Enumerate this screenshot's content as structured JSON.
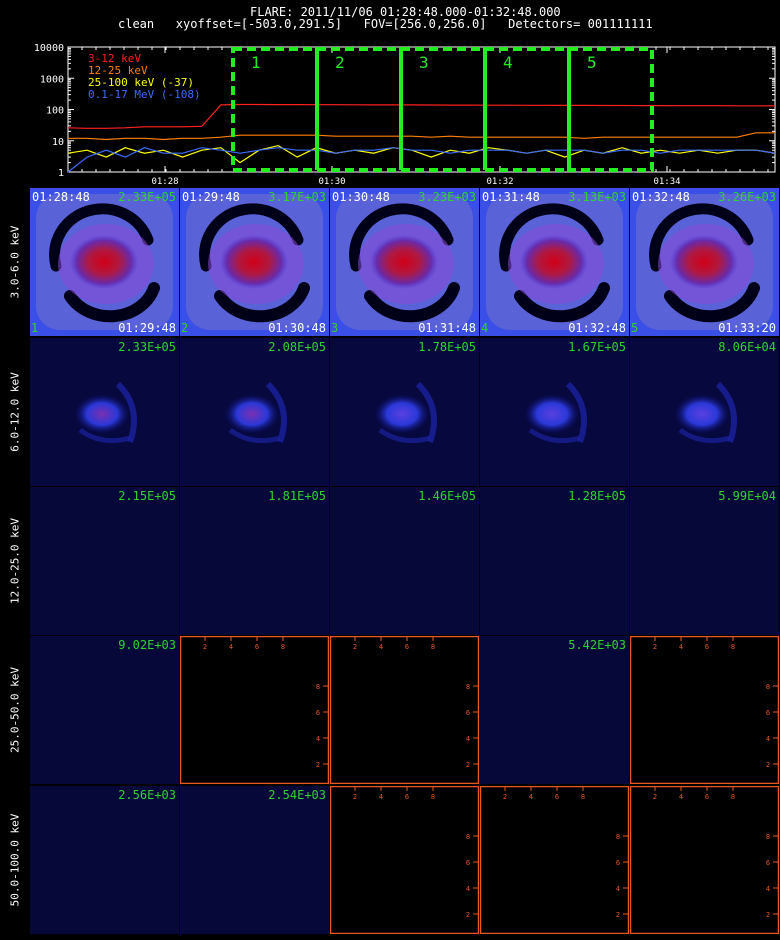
{
  "header": {
    "line1": "FLARE: 2011/11/06 01:28:48.000-01:32:48.000",
    "line2": "clean   xyoffset=[-503.0,291.5]   FOV=[256.0,256.0]   Detectors= 001111111"
  },
  "chart_data": [
    {
      "type": "line",
      "ylog": true,
      "yticks": [
        "10000",
        "1000",
        "100",
        "10",
        "1"
      ],
      "xticks": [
        "01:28",
        "01:30",
        "01:32",
        "01:34"
      ],
      "series": [
        {
          "name": "3-12 keV",
          "color": "#ff2020",
          "values": [
            26,
            25,
            25,
            26,
            28,
            28,
            28,
            29,
            140,
            145,
            145,
            143,
            143,
            142,
            142,
            141,
            140,
            140,
            140,
            139,
            138,
            138,
            137,
            137,
            136,
            136,
            135,
            135,
            134,
            134,
            133,
            133,
            132,
            132,
            132,
            131,
            131,
            130
          ]
        },
        {
          "name": "12-25 keV",
          "color": "#ff8000",
          "values": [
            12,
            12,
            11,
            12,
            12,
            11,
            12,
            12,
            13,
            15,
            15,
            15,
            15,
            15,
            14,
            14,
            14,
            14,
            14,
            13,
            14,
            13,
            13,
            13,
            13,
            13,
            13,
            12,
            13,
            13,
            13,
            13,
            13,
            13,
            13,
            13,
            18,
            18
          ]
        },
        {
          "name": "25-100 keV (-37)",
          "color": "#ffff00",
          "values": [
            4,
            5,
            3,
            6,
            4,
            5,
            3,
            5,
            6,
            2,
            5,
            7,
            3,
            6,
            4,
            5,
            4,
            6,
            5,
            3,
            5,
            4,
            6,
            5,
            4,
            5,
            3,
            5,
            4,
            6,
            4,
            5,
            4,
            5,
            4,
            5,
            5,
            4
          ]
        },
        {
          "name": "0.1-17 MeV (-108)",
          "color": "#3a6cff",
          "values": [
            1,
            3,
            5,
            3,
            6,
            4,
            4,
            6,
            5,
            4,
            5,
            6,
            5,
            5,
            4,
            5,
            5,
            6,
            5,
            5,
            4,
            5,
            5,
            5,
            4,
            5,
            5,
            5,
            4,
            5,
            5,
            4,
            5,
            5,
            5,
            5,
            5,
            4
          ]
        }
      ],
      "intervals": [
        {
          "label": "1"
        },
        {
          "label": "2"
        },
        {
          "label": "3"
        },
        {
          "label": "4"
        },
        {
          "label": "5"
        }
      ]
    },
    {
      "type": "heatmap",
      "row_labels": [
        "3.0-6.0 keV",
        "6.0-12.0 keV",
        "12.0-25.0 keV",
        "25.0-50.0 keV",
        "50.0-100.0 keV"
      ],
      "time_starts": [
        "01:28:48",
        "01:29:48",
        "01:30:48",
        "01:31:48",
        "01:32:48"
      ],
      "time_ends": [
        "01:29:48",
        "01:30:48",
        "01:31:48",
        "01:32:48",
        "01:33:20"
      ],
      "indices": [
        "1",
        "2",
        "3",
        "4",
        "5"
      ],
      "cell_values": [
        [
          "2.33E+05",
          "3.17E+03",
          "3.23E+03",
          "3.13E+03",
          "3.26E+03"
        ],
        [
          "2.33E+05",
          "2.08E+05",
          "1.78E+05",
          "1.67E+05",
          "8.06E+04"
        ],
        [
          "2.15E+05",
          "1.81E+05",
          "1.46E+05",
          "1.28E+05",
          "5.99E+04"
        ],
        [
          "9.02E+03",
          "",
          "",
          "5.42E+03",
          ""
        ],
        [
          "2.56E+03",
          "2.54E+03",
          "",
          "",
          ""
        ]
      ],
      "cell_kinds": [
        [
          "ring",
          "ring",
          "ring",
          "ring",
          "ring"
        ],
        [
          "blob",
          "blob",
          "blob",
          "blob",
          "blob"
        ],
        [
          "faint",
          "faint",
          "faint",
          "faint",
          "faint"
        ],
        [
          "faint",
          "empty",
          "empty",
          "faint",
          "empty"
        ],
        [
          "faint",
          "faint",
          "empty",
          "empty",
          "empty"
        ]
      ],
      "empty_axis_ticks": [
        "2",
        "4",
        "6",
        "8"
      ]
    }
  ]
}
